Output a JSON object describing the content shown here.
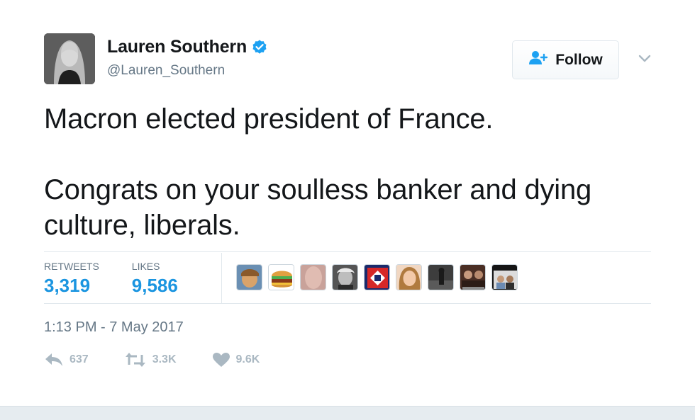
{
  "tweet": {
    "author": {
      "name": "Lauren Southern",
      "handle": "@Lauren_Southern",
      "verified": true
    },
    "follow_label": "Follow",
    "text_paragraphs": [
      "Macron elected president of France.",
      "Congrats on your soulless banker and dying culture, liberals."
    ],
    "stats": {
      "retweets_label": "RETWEETS",
      "retweets_value": "3,319",
      "likes_label": "LIKES",
      "likes_value": "9,586"
    },
    "timestamp": "1:13 PM - 7 May 2017",
    "actions": {
      "reply_count": "637",
      "retweet_count": "3.3K",
      "like_count": "9.6K"
    }
  },
  "colors": {
    "link_blue": "#1b95e0",
    "verified_blue": "#1da1f2",
    "muted_gray": "#657786",
    "icon_gray": "#aab8c2"
  },
  "icons": {
    "verified": "verified-badge-icon",
    "follow": "person-add-icon",
    "more": "chevron-down-icon",
    "reply": "reply-icon",
    "retweet": "retweet-icon",
    "like": "heart-icon"
  }
}
